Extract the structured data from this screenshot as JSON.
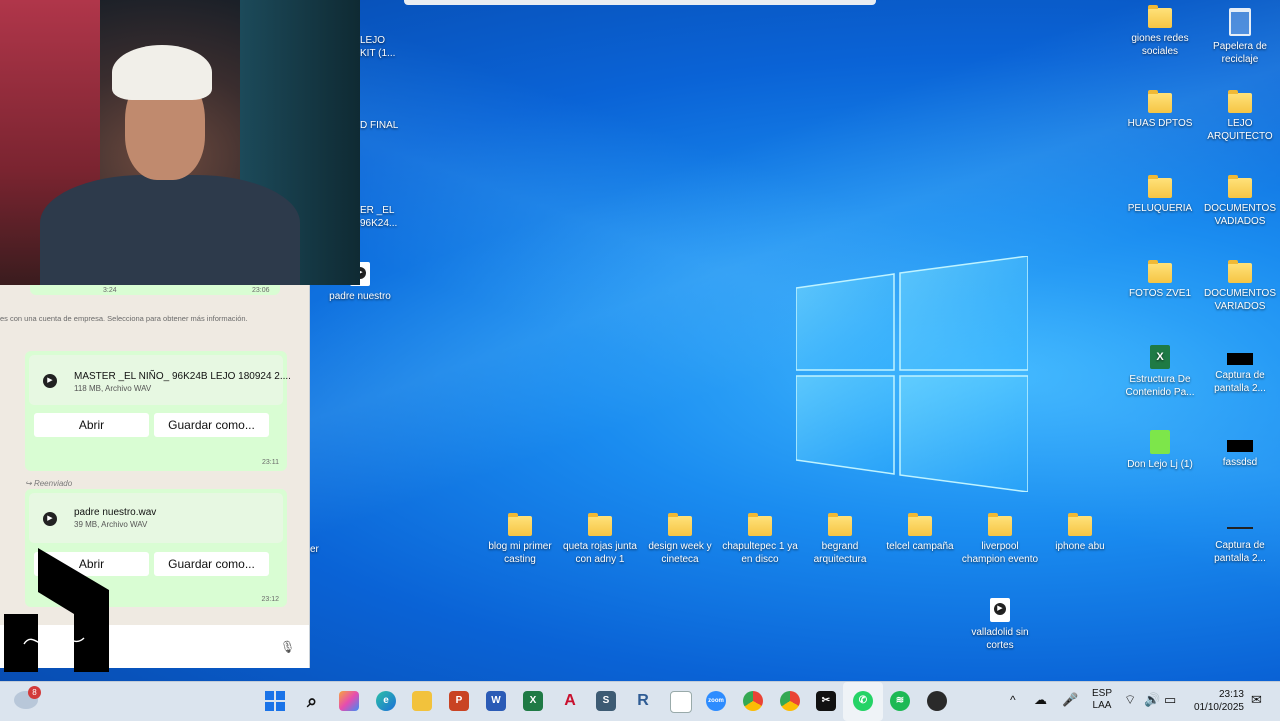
{
  "desktop": {
    "right_icons": [
      {
        "label": "giones redes sociales",
        "kind": "folder"
      },
      {
        "label": "Papelera de reciclaje",
        "kind": "bin"
      },
      {
        "label": "HUAS DPTOS",
        "kind": "folder"
      },
      {
        "label": "LEJO ARQUITECTO",
        "kind": "folder"
      },
      {
        "label": "PELUQUERIA",
        "kind": "folder"
      },
      {
        "label": "DOCUMENTOS VADIADOS",
        "kind": "folder"
      },
      {
        "label": "FOTOS ZVE1",
        "kind": "folder"
      },
      {
        "label": "DOCUMENTOS VARIADOS",
        "kind": "folder"
      },
      {
        "label": "Estructura De Contenido Pa...",
        "kind": "excel"
      },
      {
        "label": "Captura de pantalla 2...",
        "kind": "image"
      },
      {
        "label": "Don Lejo Lj (1)",
        "kind": "green-doc"
      },
      {
        "label": "fassdsd",
        "kind": "image"
      },
      {
        "label": "Captura de pantalla 2...",
        "kind": "image"
      }
    ],
    "bottom_row_icons": [
      {
        "label": "blog mi primer casting",
        "kind": "folder"
      },
      {
        "label": "queta rojas junta con adny 1",
        "kind": "folder"
      },
      {
        "label": "design week y cineteca",
        "kind": "folder"
      },
      {
        "label": "chapultepec 1 ya en disco",
        "kind": "folder"
      },
      {
        "label": "begrand arquitectura",
        "kind": "folder"
      },
      {
        "label": "telcel campaña",
        "kind": "folder"
      },
      {
        "label": "liverpool champion evento",
        "kind": "folder"
      },
      {
        "label": "iphone abu",
        "kind": "folder"
      },
      {
        "label": "valladolid sin cortes",
        "kind": "media"
      }
    ],
    "partial_icons": [
      {
        "label": "LEJO KIT (1..."
      },
      {
        "label": "D FINAL"
      },
      {
        "label": "ER _EL 96K24..."
      },
      {
        "label": "padre nuestro"
      },
      {
        "label": "er"
      }
    ]
  },
  "whatsapp": {
    "top_time_left": "3:24",
    "top_time_right": "23:06",
    "notice": "es con una cuenta de empresa. Selecciona para obtener más información.",
    "messages": [
      {
        "file_name": "MASTER _EL NIÑO_ 96K24B LEJO 180924 2....",
        "file_meta": "118 MB, Archivo WAV",
        "open_label": "Abrir",
        "save_label": "Guardar como...",
        "time": "23:11"
      },
      {
        "forwarded": "Reenviado",
        "file_name": "padre nuestro.wav",
        "file_meta": "39 MB, Archivo WAV",
        "open_label": "Abrir",
        "save_label": "Guardar como...",
        "time": "23:12"
      }
    ]
  },
  "taskbar": {
    "weather_badge": "8",
    "apps": [
      "start",
      "search",
      "copilot",
      "edge",
      "file-explorer",
      "powerpoint",
      "word",
      "excel",
      "autocad",
      "sketchup",
      "revit",
      "notepad",
      "zoom",
      "chrome",
      "chrome-2",
      "capcut",
      "whatsapp",
      "spotify",
      "obs"
    ],
    "language_top": "ESP",
    "language_bottom": "LAA",
    "time": "23:13",
    "date": "01/10/2025"
  }
}
